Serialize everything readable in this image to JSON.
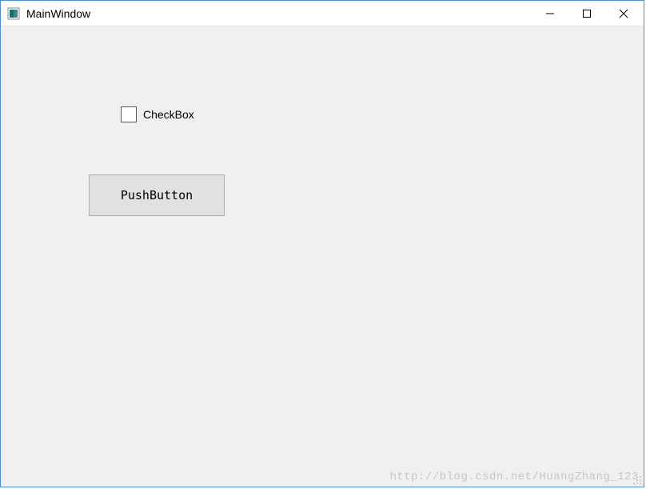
{
  "window": {
    "title": "MainWindow"
  },
  "controls": {
    "checkbox_label": "CheckBox",
    "pushbutton_label": "PushButton"
  },
  "watermark": "http://blog.csdn.net/HuangZhang_123"
}
